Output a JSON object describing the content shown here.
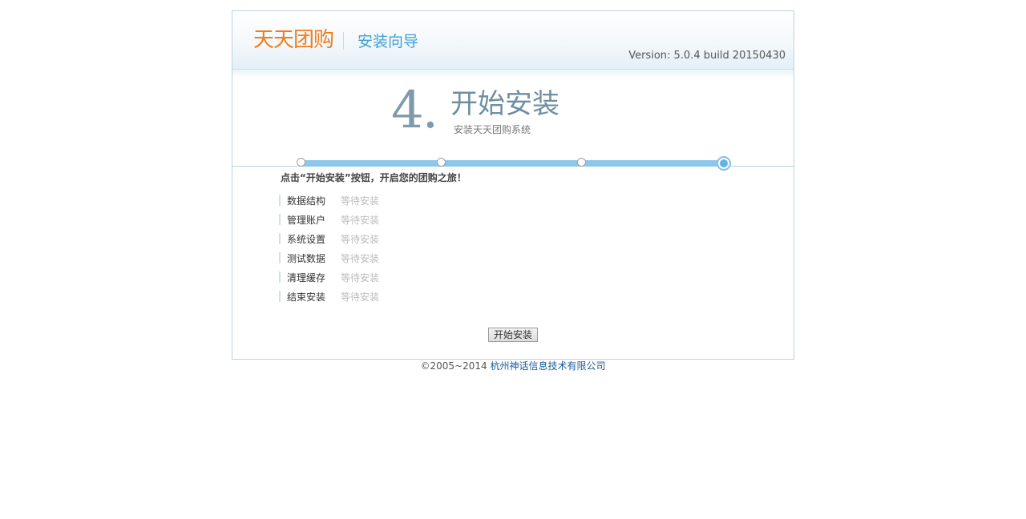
{
  "header": {
    "logo_text": "天天团购",
    "wizard_title": "安装向导",
    "version": "Version: 5.0.4 build 20150430"
  },
  "step": {
    "number": "4.",
    "title": "开始安装",
    "subtitle": "安装天天团购系统"
  },
  "progress": {
    "total_steps": 4,
    "current_step": 4
  },
  "instruction": "点击“开始安装”按钮，开启您的团购之旅！",
  "tasks": [
    {
      "name": "数据结构",
      "status": "等待安装"
    },
    {
      "name": "管理账户",
      "status": "等待安装"
    },
    {
      "name": "系统设置",
      "status": "等待安装"
    },
    {
      "name": "测试数据",
      "status": "等待安装"
    },
    {
      "name": "清理缓存",
      "status": "等待安装"
    },
    {
      "name": "结束安装",
      "status": "等待安装"
    }
  ],
  "buttons": {
    "start_install": "开始安装"
  },
  "footer": {
    "copyright": "©2005~2014",
    "company": "杭州神话信息技术有限公司"
  },
  "colors": {
    "logo": "#ef7d1a",
    "accent": "#3fa1d4",
    "progress": "#8cc7ea",
    "border": "#b9d3e0"
  }
}
